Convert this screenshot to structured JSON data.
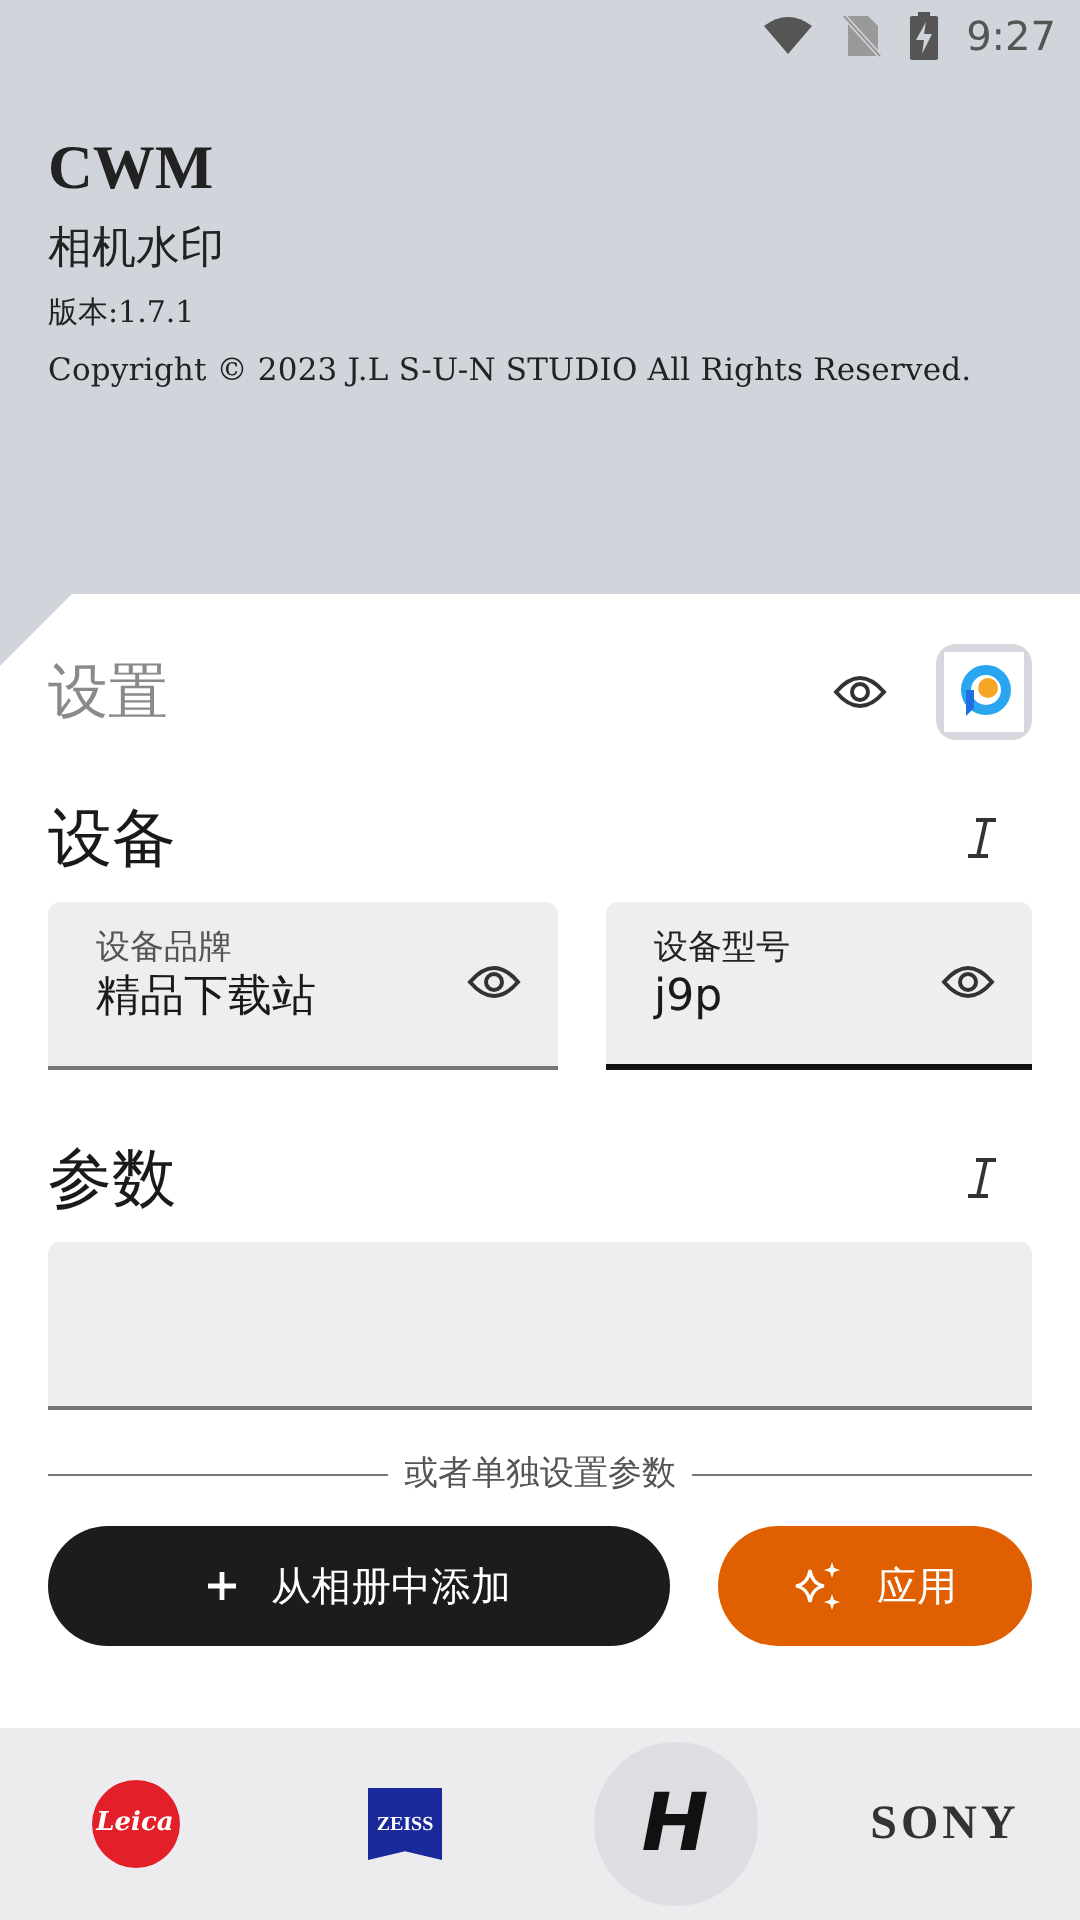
{
  "status_bar": {
    "time": "9:27"
  },
  "header": {
    "title": "CWM",
    "subtitle": "相机水印",
    "version": "版本:1.7.1",
    "copyright": "Copyright © 2023 J.L S-U-N STUDIO All Rights Reserved."
  },
  "settings": {
    "title": "设置"
  },
  "device": {
    "title": "设备",
    "fields": [
      {
        "label": "设备品牌",
        "value": "精品下载站",
        "focused": false
      },
      {
        "label": "设备型号",
        "value": "j9p",
        "focused": true
      }
    ]
  },
  "params": {
    "title": "参数",
    "value_field": {
      "focused": false
    }
  },
  "divider_text": "或者单独设置参数",
  "buttons": [
    {
      "kind": "add",
      "label": "从相册中添加"
    },
    {
      "kind": "apply",
      "label": "应用"
    }
  ],
  "brands": [
    {
      "kind": "leica",
      "label": "Leica",
      "selected": false
    },
    {
      "kind": "zeiss",
      "label": "ZEISS",
      "selected": false
    },
    {
      "kind": "hasselblad",
      "label": "H",
      "selected": true
    },
    {
      "kind": "sony",
      "label": "SONY",
      "selected": false
    }
  ]
}
